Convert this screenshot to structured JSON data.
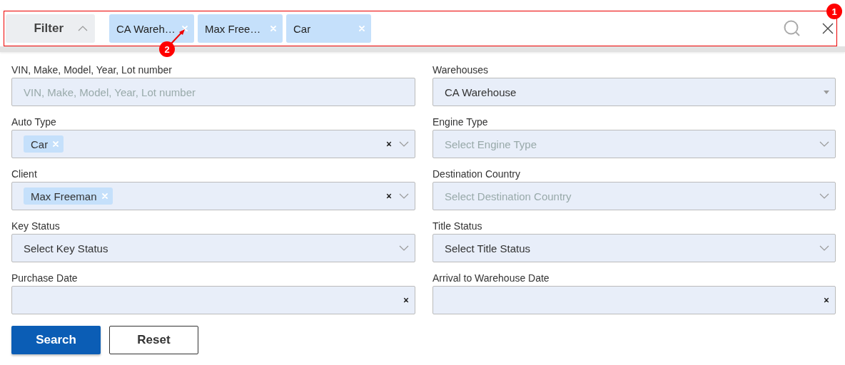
{
  "filter_bar": {
    "toggle": {
      "label": "Filter",
      "expanded": true
    },
    "chips": [
      {
        "label": "CA Wareh…"
      },
      {
        "label": "Max Free…"
      },
      {
        "label": "Car"
      }
    ]
  },
  "form": {
    "fields": [
      {
        "label": "VIN, Make, Model, Year, Lot number",
        "kind": "text",
        "placeholder": "VIN, Make, Model, Year, Lot number"
      },
      {
        "label": "Warehouses",
        "kind": "dropdown",
        "value": "CA Warehouse"
      },
      {
        "label": "Auto Type",
        "kind": "multi",
        "chips": [
          "Car"
        ]
      },
      {
        "label": "Engine Type",
        "kind": "select",
        "placeholder": "Select Engine Type"
      },
      {
        "label": "Client",
        "kind": "multi",
        "chips": [
          "Max Freeman"
        ]
      },
      {
        "label": "Destination Country",
        "kind": "select",
        "placeholder": "Select Destination Country"
      },
      {
        "label": "Key Status",
        "kind": "select",
        "value": "Select Key Status"
      },
      {
        "label": "Title Status",
        "kind": "select",
        "value": "Select Title Status"
      },
      {
        "label": "Purchase Date",
        "kind": "date"
      },
      {
        "label": "Arrival to Warehouse Date",
        "kind": "date"
      }
    ]
  },
  "buttons": [
    {
      "label": "Search",
      "kind": "primary"
    },
    {
      "label": "Reset",
      "kind": "secondary"
    }
  ],
  "annotations": [
    {
      "label": "1"
    },
    {
      "label": "2"
    }
  ]
}
